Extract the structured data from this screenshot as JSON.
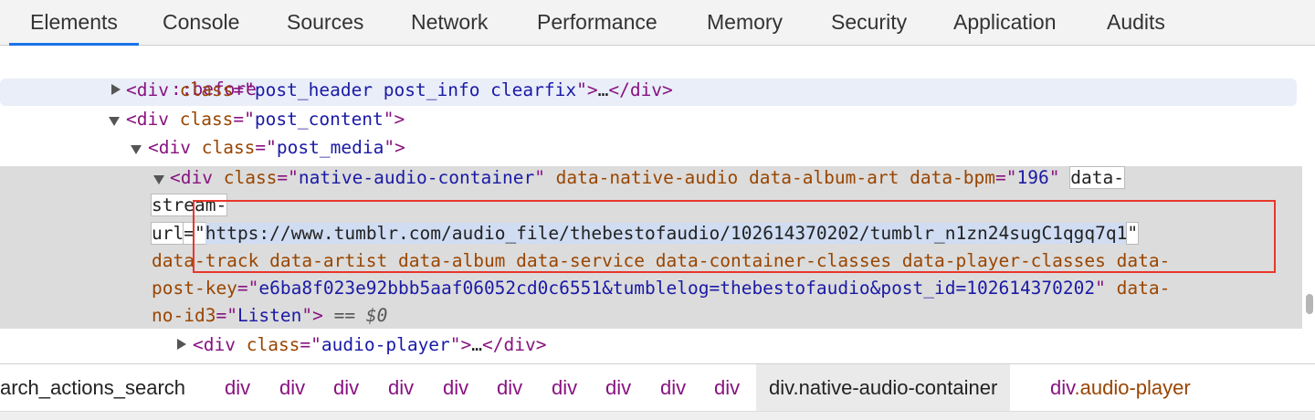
{
  "tabs": [
    {
      "label": "Elements"
    },
    {
      "label": "Console"
    },
    {
      "label": "Sources"
    },
    {
      "label": "Network"
    },
    {
      "label": "Performance"
    },
    {
      "label": "Memory"
    },
    {
      "label": "Security"
    },
    {
      "label": "Application"
    },
    {
      "label": "Audits"
    }
  ],
  "active_tab": "Elements",
  "tree": {
    "before": "::before",
    "post_header": {
      "open": "<div",
      "attr": "class",
      "eq": "=\"",
      "value": "post_header post_info clearfix",
      "close": "\">",
      "ellipsis": "…",
      "end": "</div>"
    },
    "post_content": {
      "open": "<div",
      "attr": "class",
      "eq": "=\"",
      "value": "post_content",
      "close": "\">"
    },
    "post_media": {
      "open": "<div",
      "attr": "class",
      "eq": "=\"",
      "value": "post_media",
      "close": "\">"
    },
    "native": {
      "open": "<div",
      "attr": "class",
      "eq": "=\"",
      "value": "native-audio-container",
      "q": "\"",
      "flags1": " data-native-audio data-album-art data-bpm",
      "bpm_eq": "=\"",
      "bpm": "196",
      "bpm_q": "\"",
      "stream_attr_1": "data-",
      "stream_attr_2": "stream-",
      "stream_attr_3": "url",
      "stream_eq": "=\"",
      "stream_url": "https://www.tumblr.com/audio_file/thebestofaudio/102614370202/tumblr_n1zn24sugC1qgq7q1",
      "stream_q": "\"",
      "flags2": "data-track data-artist data-album data-service data-container-classes data-player-classes data-",
      "postkey_attr": "post-key",
      "postkey_eq": "=\"",
      "postkey": "e6ba8f023e92bbb5aaf06052cd0c6551&tumblelog=thebestofaudio&post_id=102614370202",
      "postkey_q": "\"",
      "data_tail": " data-",
      "id3_attr": "no-id3",
      "id3_eq": "=\"",
      "id3": "Listen",
      "id3_close": "\">",
      "dollar": " == $0"
    },
    "audio_player": {
      "open": "<div",
      "attr": "class",
      "eq": "=\"",
      "value": "audio-player",
      "close": "\">",
      "ellipsis": "…",
      "end": "</div>"
    }
  },
  "breadcrumbs": {
    "first": "arch_actions_search",
    "divs": [
      "div",
      "div",
      "div",
      "div",
      "div",
      "div",
      "div",
      "div",
      "div",
      "div"
    ],
    "active_tag": "div",
    "active_class": ".native-audio-container",
    "last_tag": "div",
    "last_class": ".audio-player"
  }
}
